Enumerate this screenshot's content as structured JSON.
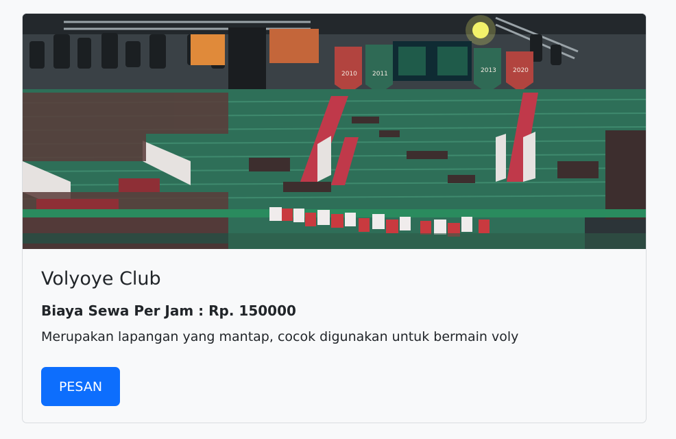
{
  "card": {
    "title": "Volyoye Club",
    "price_label": "Biaya Sewa Per Jam : Rp. 150000",
    "description": "Merupakan lapangan yang mantap, cocok digunakan untuk bermain voly",
    "book_button_label": "PESAN",
    "image": {
      "subject": "indoor volleyball arena with green stands and crowd",
      "banners": [
        "2010",
        "2011",
        "2013",
        "2020"
      ]
    }
  },
  "colors": {
    "page_bg": "#f8f9fa",
    "card_border": "#d9dcdf",
    "button_bg": "#0d6efd",
    "button_text": "#ffffff",
    "text": "#212529",
    "stands_green": "#2f7a5f",
    "stands_red": "#c0394a"
  }
}
